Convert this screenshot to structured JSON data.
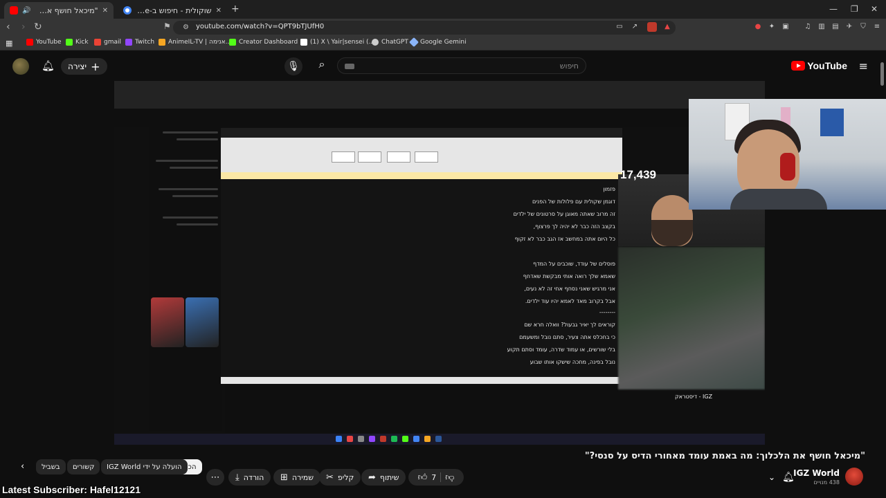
{
  "browser": {
    "tabs": [
      {
        "label": "\"מיכאל חושף את הלכלוך: מה",
        "active": true
      },
      {
        "label": "שוקולית - חיפוש ב-Google",
        "active": false
      }
    ],
    "new_tab": "+",
    "url": "youtube.com/watch?v=QPT9bTJUfH0",
    "bookmarks": [
      {
        "label": "YouTube",
        "color": "#ff0000"
      },
      {
        "label": "Kick",
        "color": "#53fc18"
      },
      {
        "label": "gmail",
        "color": "#ea4335"
      },
      {
        "label": "Twitch",
        "color": "#9146ff"
      },
      {
        "label": "AnimeIL-TV | אנימה...",
        "color": "#f5a623"
      },
      {
        "label": "Creator Dashboard |...",
        "color": "#53fc18"
      },
      {
        "label": "(1) X \\ Yair|sensei (...",
        "color": "#ffffff"
      },
      {
        "label": "ChatGPT",
        "color": "#cccccc"
      },
      {
        "label": "Google Gemini",
        "color": "#8ab4f8"
      }
    ]
  },
  "youtube": {
    "logo": "YouTube",
    "search_placeholder": "חיפוש",
    "create_label": "יצירה"
  },
  "video": {
    "viewer_count": "17,439",
    "inner_channel": "IGZ - דיסטראק",
    "doc_lines": [
      "פזמון",
      "דוגמן שקולית עם פלולות של הפנים",
      "זה מרוב שאתה מאוגן על סרטונים של ילדים",
      "בקצב הזה כבר לא יהיה לך פרצוף,",
      "כל היום אתה במחשב אז הגב כבר לא זקוף",
      "",
      "פוסלים של עודד, שוכבים על המדף",
      "שאמא שלך רואה אותי מבקשת שאדחף",
      "אני מרגיש שאני נסחף אחי זה לא נעים,",
      "אבל בקרוב מאד לאמא יהיו עוד ילדים.",
      "--------",
      "קוראים לך יאיר גבעול? וואלה חרא שם",
      "כי בחכלס אתה צעיר, סתם נובל ומשעמם",
      "בלי שורשים, או עמוד שדרה, עומד וסתם תקוע",
      "נובל בפינה, מחכה שישקו אותו שבוע"
    ]
  },
  "info": {
    "title": "\"מיכאל חושף את הלכלוך: מה באמת עומד מאחורי הדיס על סנסי?\"",
    "channel_name": "IGZ World",
    "subscribers": "438 מנויים",
    "like_count": "7",
    "actions": {
      "share": "שיתוף",
      "clip": "קליפ",
      "save": "שמירה",
      "download": "הורדה"
    },
    "chips": [
      "הכל",
      "IGZ World הועלה על ידי",
      "קשורים",
      "בשביל"
    ]
  },
  "overlay_text": "Latest Subscriber: Hafel12121"
}
